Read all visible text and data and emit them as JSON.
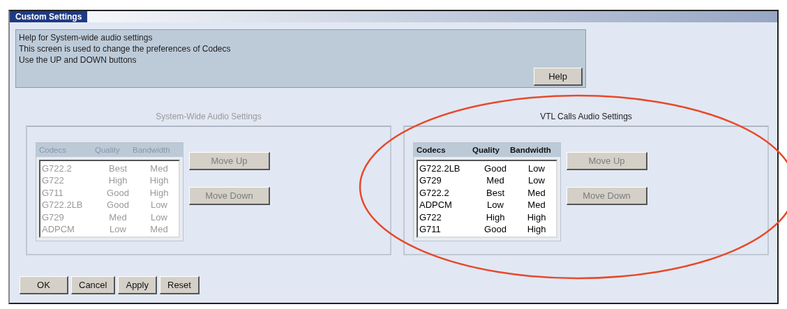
{
  "window": {
    "title": "Custom Settings"
  },
  "help": {
    "lines": [
      "Help for System-wide audio settings",
      "This screen is used to change the preferences of Codecs",
      "Use the UP and DOWN buttons"
    ],
    "button": "Help"
  },
  "panels": [
    {
      "title": "System-Wide Audio Settings",
      "disabled": true,
      "highlighted": false,
      "columns": [
        "Codecs",
        "Quality",
        "Bandwidth"
      ],
      "rows": [
        {
          "codec": "G722.2",
          "quality": "Best",
          "bandwidth": "Med"
        },
        {
          "codec": "G722",
          "quality": "High",
          "bandwidth": "High"
        },
        {
          "codec": "G711",
          "quality": "Good",
          "bandwidth": "High"
        },
        {
          "codec": "G722.2LB",
          "quality": "Good",
          "bandwidth": "Low"
        },
        {
          "codec": "G729",
          "quality": "Med",
          "bandwidth": "Low"
        },
        {
          "codec": "ADPCM",
          "quality": "Low",
          "bandwidth": "Med"
        }
      ],
      "buttons": [
        {
          "label": "Move Up",
          "disabled": true
        },
        {
          "label": "Move Down",
          "disabled": true
        }
      ]
    },
    {
      "title": "VTL Calls Audio Settings",
      "disabled": false,
      "highlighted": true,
      "columns": [
        "Codecs",
        "Quality",
        "Bandwidth"
      ],
      "rows": [
        {
          "codec": "G722.2LB",
          "quality": "Good",
          "bandwidth": "Low"
        },
        {
          "codec": "G729",
          "quality": "Med",
          "bandwidth": "Low"
        },
        {
          "codec": "G722.2",
          "quality": "Best",
          "bandwidth": "Med"
        },
        {
          "codec": "ADPCM",
          "quality": "Low",
          "bandwidth": "Med"
        },
        {
          "codec": "G722",
          "quality": "High",
          "bandwidth": "High"
        },
        {
          "codec": "G711",
          "quality": "Good",
          "bandwidth": "High"
        }
      ],
      "buttons": [
        {
          "label": "Move Up",
          "disabled": true
        },
        {
          "label": "Move Down",
          "disabled": true
        }
      ]
    }
  ],
  "buttons": [
    "OK",
    "Cancel",
    "Apply",
    "Reset"
  ]
}
